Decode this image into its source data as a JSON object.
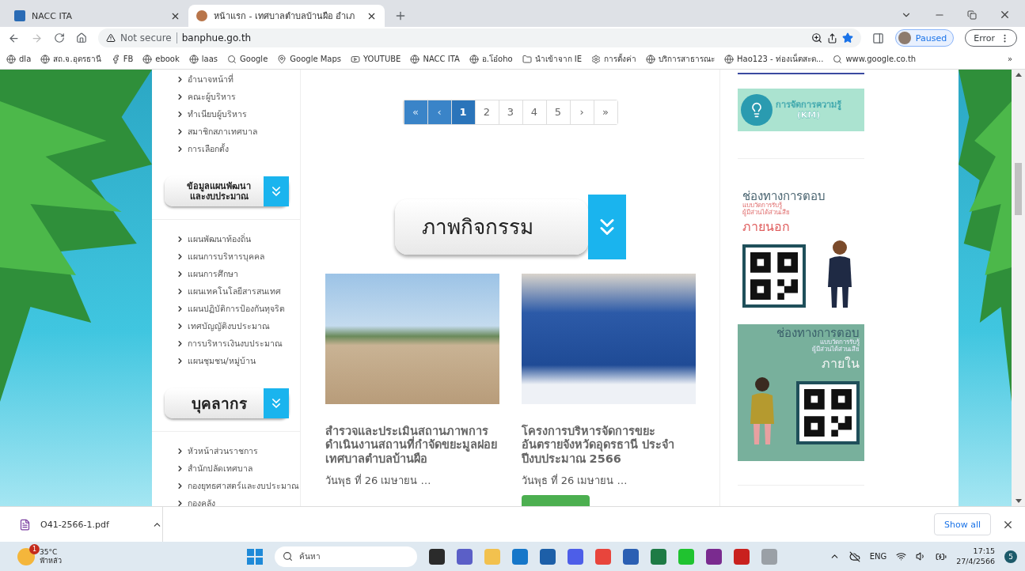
{
  "tabs": [
    {
      "label": "NACC ITA",
      "selected": false
    },
    {
      "label": "หน้าแรก - เทศบาลตำบลบ้านผือ อำเภ",
      "selected": true
    }
  ],
  "toolbar": {
    "security": "Not secure",
    "url": "banphue.go.th",
    "profile": "Paused",
    "error": "Error"
  },
  "bookmarks": [
    "dla",
    "สถ.จ.อุดรธานี",
    "FB",
    "ebook",
    "laas",
    "Google",
    "Google Maps",
    "YOUTUBE",
    "NACC ITA",
    "อ.โอ๋oho",
    "นำเข้าจาก IE",
    "การตั้งค่า",
    "บริการสาธารณะ",
    "Hao123 - ท่องเน็ตสะด...",
    "www.google.co.th"
  ],
  "bookmarks_more": "»",
  "sidebar": [
    {
      "kind": "list",
      "items": [
        "อำนาจหน้าที่",
        "คณะผู้บริหาร",
        "ทำเนียบผู้บริหาร",
        "สมาชิกสภาเทศบาล",
        "การเลือกตั้ง"
      ]
    },
    {
      "kind": "header",
      "lines": [
        "ข้อมูลแผนพัฒนา",
        "และงบประมาณ"
      ]
    },
    {
      "kind": "list",
      "items": [
        "แผนพัฒนาท้องถิ่น",
        "แผนการบริหารบุคคล",
        "แผนการศึกษา",
        "แผนเทคโนโลยีสารสนเทศ",
        "แผนปฏิบัติการป้องกันทุจริต",
        "เทศบัญญัติงบประมาณ",
        "การบริหารเงินงบประมาณ",
        "แผนชุมชน/หมู่บ้าน"
      ]
    },
    {
      "kind": "header",
      "lines": [
        "บุคลากร"
      ]
    },
    {
      "kind": "list",
      "items": [
        "หัวหน้าส่วนราชการ",
        "สำนักปลัดเทศบาล",
        "กองยุทธศาสตร์และงบประมาณ",
        "กองคลัง"
      ]
    }
  ],
  "pagination": [
    {
      "label": "«",
      "disabled": true,
      "selected": false
    },
    {
      "label": "‹",
      "disabled": true,
      "selected": false
    },
    {
      "label": "1",
      "disabled": false,
      "selected": true
    },
    {
      "label": "2",
      "disabled": false,
      "selected": false
    },
    {
      "label": "3",
      "disabled": false,
      "selected": false
    },
    {
      "label": "4",
      "disabled": false,
      "selected": false
    },
    {
      "label": "5",
      "disabled": false,
      "selected": false
    },
    {
      "label": "›",
      "disabled": false,
      "selected": false
    },
    {
      "label": "»",
      "disabled": false,
      "selected": false
    }
  ],
  "section_title": "ภาพกิจกรรม",
  "cards": [
    {
      "title": "สำรวจและประเมินสถานภาพการดำเนินงานสถานที่กำจัดขยะมูลฝอย เทศบาลตำบลบ้านผือ",
      "date": "วันพุธ ที่ 26 เมษายน …"
    },
    {
      "title": "โครงการบริหารจัดการขยะอันตรายจังหวัดอุดรธานี ประจำปีงบประมาณ 2566",
      "date": "วันพุธ ที่ 26 เมษายน …"
    }
  ],
  "km_banner": {
    "title": "การจัดการความรู้",
    "subtitle": "(KM)"
  },
  "survey_banners": [
    {
      "kind": "external",
      "heading": "ช่องทางการตอบ",
      "line1": "แบบวัดการรับรู้",
      "line2": "ผู้มีส่วนได้ส่วนเสีย",
      "audience": "ภายนอก"
    },
    {
      "kind": "internal",
      "heading": "ช่องทางการตอบ",
      "line1": "แบบวัดการรับรู้",
      "line2": "ผู้มีส่วนได้ส่วนเสีย",
      "audience": "ภายใน"
    }
  ],
  "download": {
    "file": "O41-2566-1.pdf",
    "show_all": "Show all"
  },
  "taskbar": {
    "temp": "35°C",
    "weather": "ฟ้าหลัว",
    "weather_badge": "1",
    "search": "ค้นหา",
    "lang": "ENG",
    "time": "17:15",
    "date": "27/4/2566",
    "notif": "5"
  }
}
